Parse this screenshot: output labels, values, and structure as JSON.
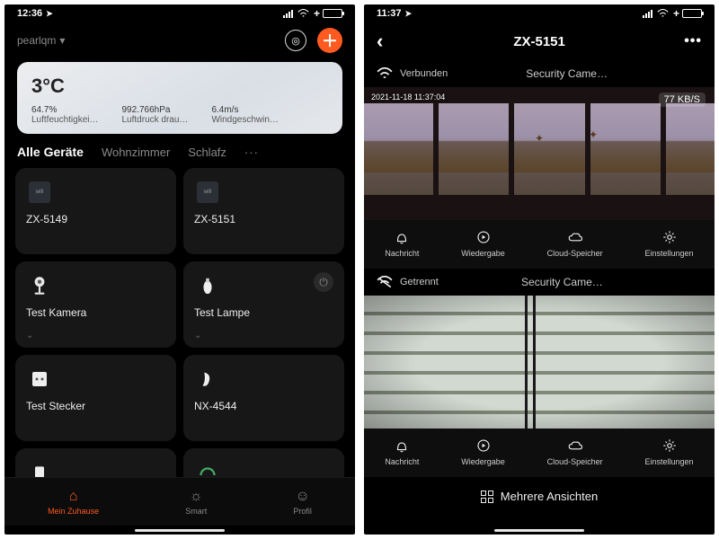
{
  "left": {
    "status": {
      "time": "12:36"
    },
    "header": {
      "account": "pearlqm"
    },
    "weather": {
      "temp": "3°C",
      "humidity_val": "64.7%",
      "humidity_lbl": "Luftfeuchtigkei…",
      "pressure_val": "992.766hPa",
      "pressure_lbl": "Luftdruck drau…",
      "wind_val": "6.4m/s",
      "wind_lbl": "Windgeschwin…"
    },
    "rooms": {
      "all": "Alle Geräte",
      "r1": "Wohnzimmer",
      "r2": "Schlafz",
      "more": "···"
    },
    "devices": {
      "d0": "ZX-5149",
      "d1": "ZX-5151",
      "d2": "Test Kamera",
      "d3": "Test Lampe",
      "d4": "Test Stecker",
      "d5": "NX-4544"
    },
    "tabs": {
      "home": "Mein Zuhause",
      "smart": "Smart",
      "profile": "Profil"
    }
  },
  "right": {
    "status": {
      "time": "11:37"
    },
    "title": "ZX-5151",
    "feed1": {
      "conn": "Verbunden",
      "name": "Security Came…",
      "timestamp": "2021-11-18 11:37:04",
      "rate": "77 KB/S"
    },
    "feed2": {
      "conn": "Getrennt",
      "name": "Security Came…"
    },
    "actions": {
      "a0": "Nachricht",
      "a1": "Wiedergabe",
      "a2": "Cloud-Speicher",
      "a3": "Einstellungen"
    },
    "multi": "Mehrere Ansichten"
  }
}
